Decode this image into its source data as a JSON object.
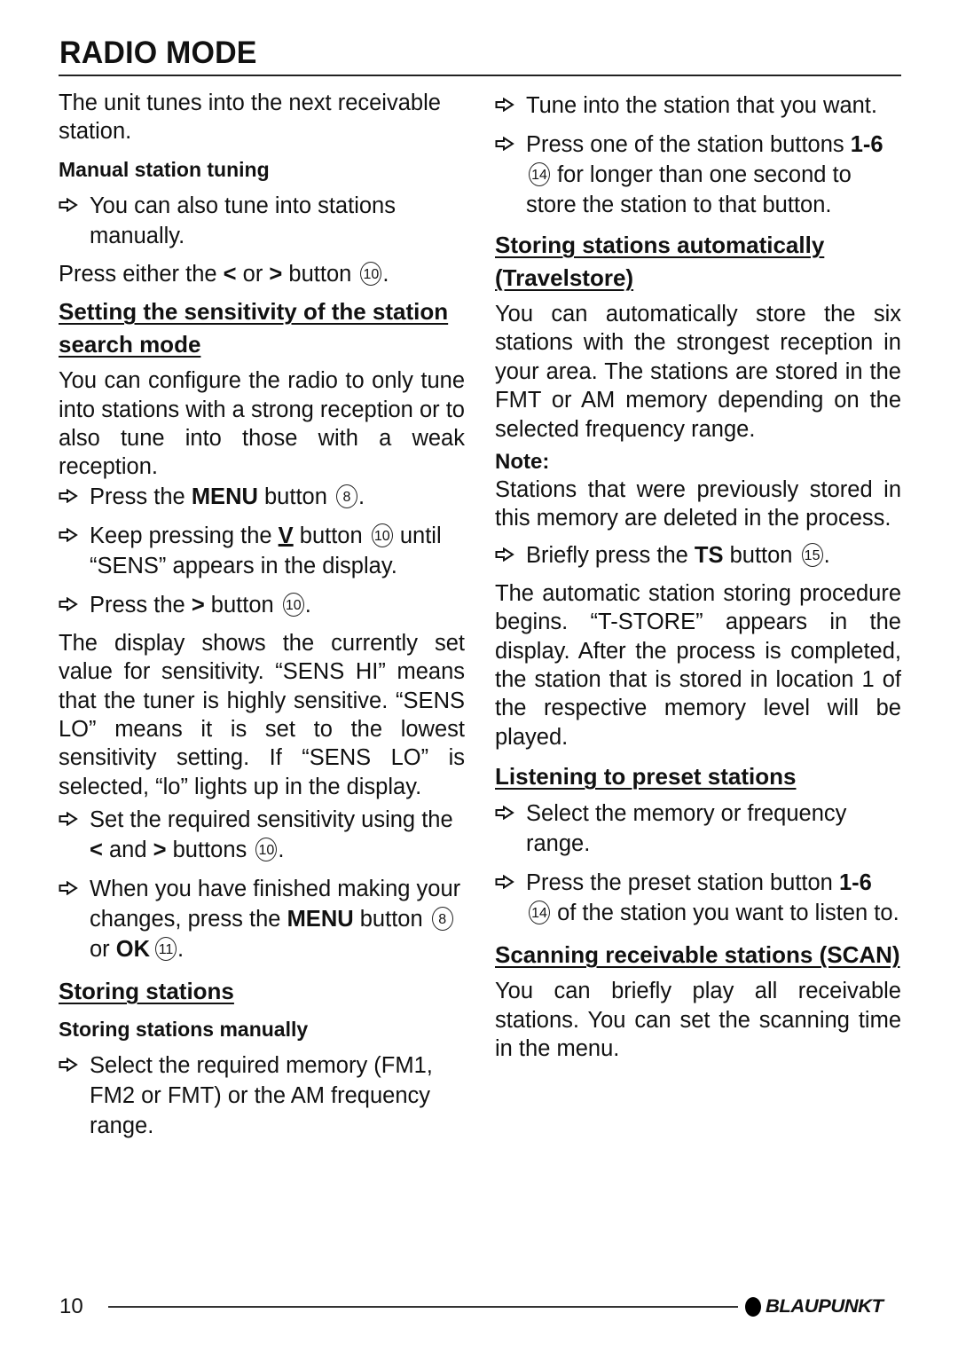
{
  "header": {
    "title": "RADIO MODE"
  },
  "left": {
    "intro": "The unit tunes into the next receivable station.",
    "manual_tuning_heading": "Manual station tuning",
    "manual_tip": "You can also tune into stations manually.",
    "press_either": {
      "pre": "Press either the ",
      "mid": " or ",
      "post": " button ",
      "num": "10",
      "end": "."
    },
    "sensitivity_heading": "Setting the sensitivity of the station search mode",
    "sensitivity_body": "You can configure the radio to only tune into stations with a strong reception or to also tune into those with a weak reception.",
    "step_menu": {
      "pre": "Press the ",
      "bold": "MENU",
      "post": " button ",
      "num": "8",
      "end": "."
    },
    "step_keep": {
      "pre": "Keep pressing the ",
      "post": " button ",
      "num": "10",
      "rest": " until “SENS” appears in the display."
    },
    "step_press_right": {
      "pre": "Press the ",
      "post": " button ",
      "num": "10",
      "end": "."
    },
    "display_body": "The display shows the currently set value for sensitivity. “SENS HI” means that the tuner is highly sensitive. “SENS LO” means it is set to the lowest sensitivity setting. If “SENS LO” is selected, “lo” lights up in the display.",
    "step_set": {
      "pre": "Set the required sensitivity using the ",
      "mid": " and ",
      "post": " buttons ",
      "num": "10",
      "end": "."
    },
    "step_finish": {
      "pre": "When you have finished making your changes, press the ",
      "bold": "MENU",
      "mid": " button ",
      "num1": "8",
      "or": " or ",
      "bold2": "OK",
      "num2": "11",
      "end": "."
    },
    "storing_heading": "Storing stations",
    "storing_manual_heading": "Storing stations manually",
    "step_select_memory": "Select the required memory (FM1, FM2 or FMT) or the AM frequency range."
  },
  "right": {
    "step_tune": "Tune into the station that you want.",
    "step_press_station": {
      "pre": "Press one of the station buttons ",
      "bold": "1-6",
      "num": "14",
      "post": " for longer than one second to store the station to that button."
    },
    "travelstore_heading": "Storing stations automatically (Travelstore)",
    "travelstore_body": "You can automatically store the six stations with the strongest reception in your area. The stations are stored in the FMT or AM memory depending on the selected frequency range.",
    "note_label": "Note:",
    "note_body": "Stations that were previously stored in this memory are deleted in the process.",
    "step_ts": {
      "pre": "Briefly press the ",
      "bold": "TS",
      "post": " button ",
      "num": "15",
      "end": "."
    },
    "auto_body": "The automatic station storing procedure begins. “T-STORE” appears in the display. After the process is completed, the station that is stored in location 1 of the respective memory level will be played.",
    "preset_heading": "Listening to preset stations",
    "step_select_range": "Select the memory or frequency range.",
    "step_preset": {
      "pre": "Press the preset station button ",
      "bold": "1-6",
      "num": "14",
      "post": " of the station you want to listen to."
    },
    "scan_heading": "Scanning receivable stations (SCAN)",
    "scan_body": "You can briefly play all receivable stations. You can set the scanning time in the menu."
  },
  "symbols": {
    "left": "<",
    "right": ">",
    "down": "V",
    "arrow_icon": "hollow-right-arrow"
  },
  "footer": {
    "page_number": "10",
    "brand": "BLAUPUNKT"
  }
}
